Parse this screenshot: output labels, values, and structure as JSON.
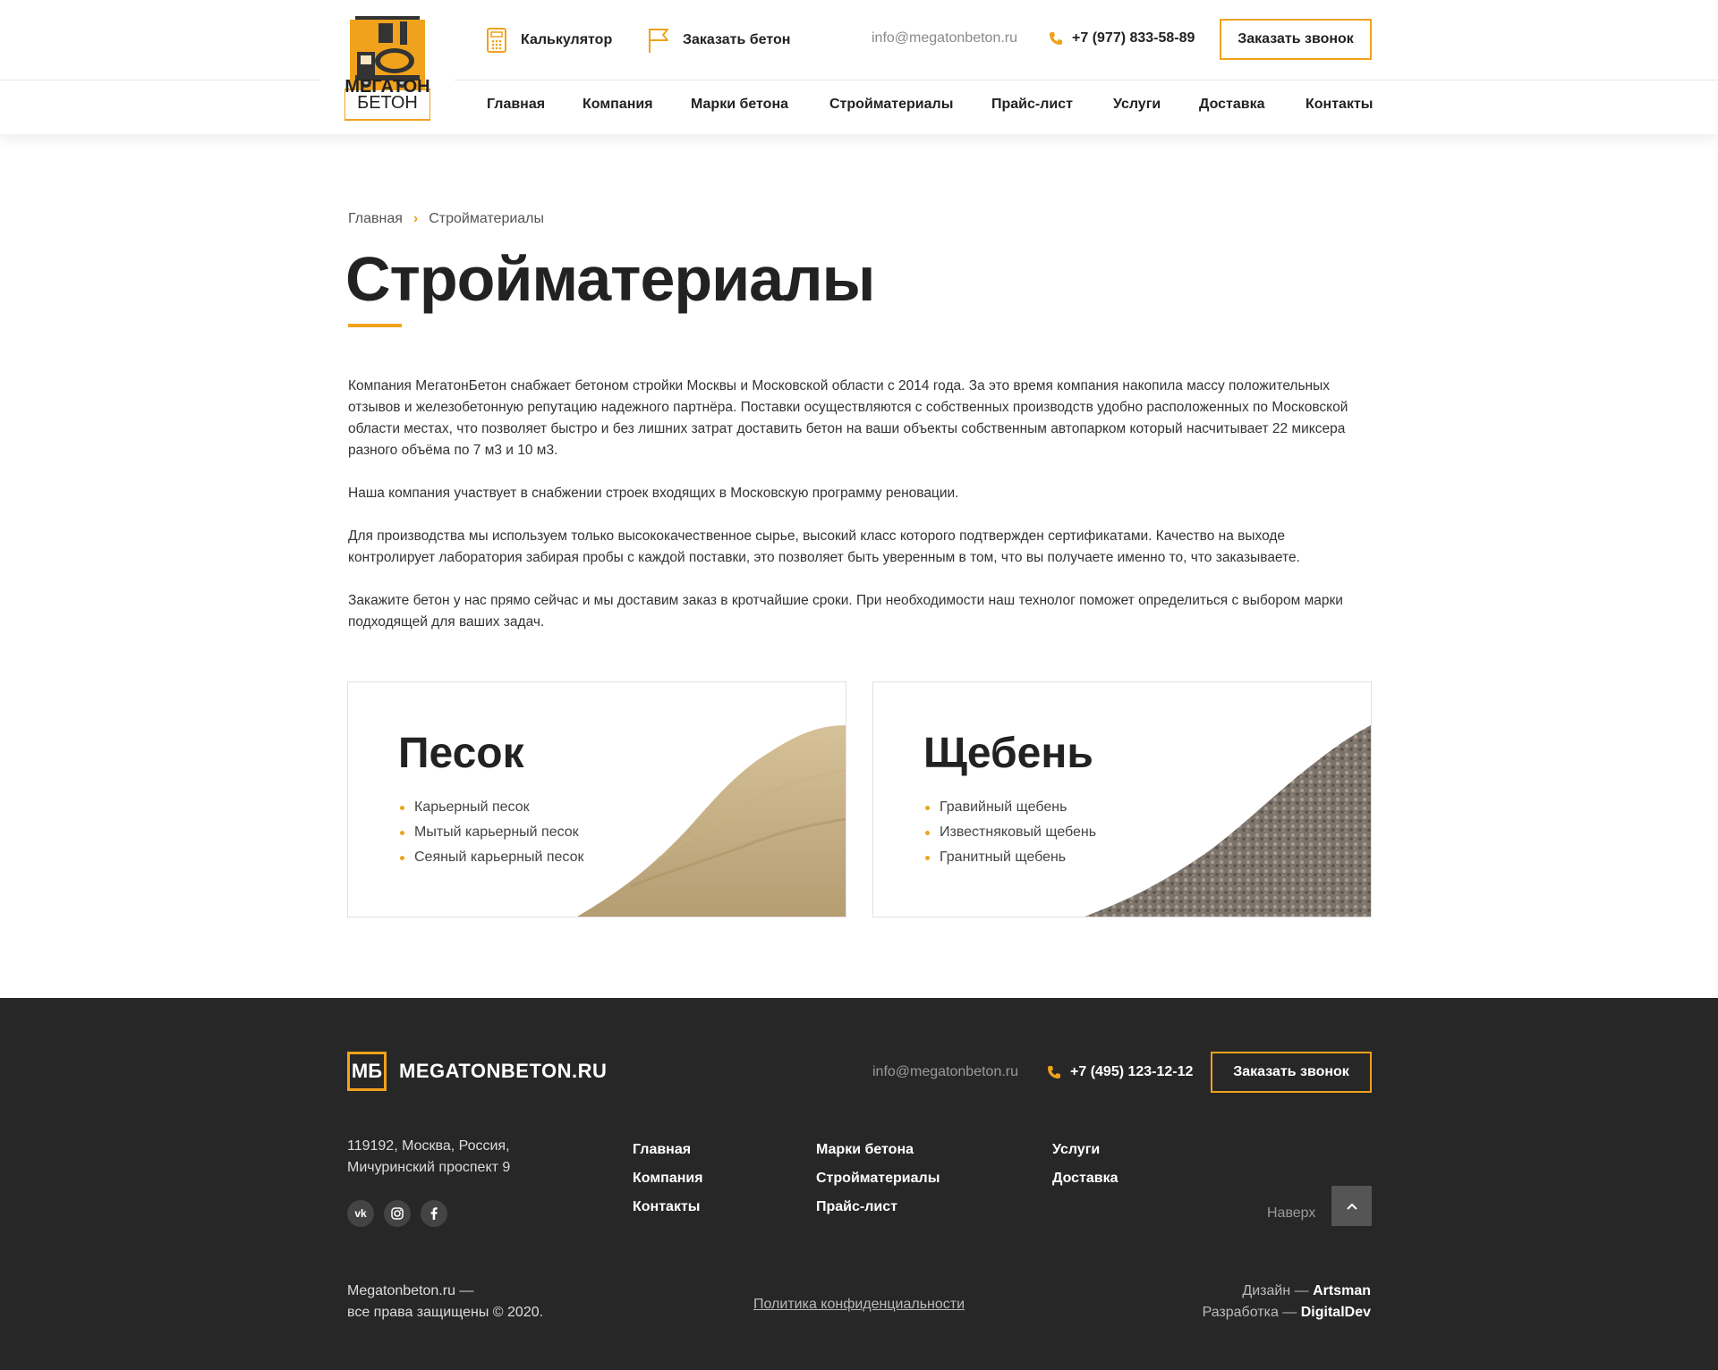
{
  "header": {
    "logo": {
      "line1": "МЕГАТОН",
      "line2": "БЕТОН"
    },
    "calculator_label": "Калькулятор",
    "order_concrete_label": "Заказать бетон",
    "email": "info@megatonbeton.ru",
    "phone": "+7 (977) 833-58-89",
    "call_button": "Заказать звонок",
    "nav": [
      "Главная",
      "Компания",
      "Марки бетона",
      "Стройматериалы",
      "Прайс-лист",
      "Услуги",
      "Доставка",
      "Контакты"
    ]
  },
  "breadcrumb": {
    "home": "Главная",
    "current": "Стройматериалы"
  },
  "page_title": "Стройматериалы",
  "intro": [
    "Компания МегатонБетон снабжает бетоном стройки Москвы и Московской области с 2014 года. За это время компания накопила массу положительных отзывов и железобетонную репутацию надежного партнёра. Поставки осуществляются с собственных производств удобно расположенных по Московской области местах, что позволяет быстро и без лишних затрат доставить бетон на ваши объекты собственным автопарком который насчитывает 22 миксера разного объёма по 7 м3 и 10 м3.",
    "Наша компания участвует в снабжении строек входящих в Московскую программу реновации.",
    "Для производства мы используем только высококачественное сырье, высокий класс которого подтвержден сертификатами. Качество на выходе контролирует лаборатория забирая пробы с каждой поставки, это позволяет быть уверенным в том, что вы получаете именно то, что заказываете.",
    "Закажите бетон у нас прямо сейчас и мы доставим заказ в кротчайшие сроки. При необходимости наш технолог поможет определиться с выбором марки подходящей для ваших задач."
  ],
  "cards": [
    {
      "title": "Песок",
      "items": [
        "Карьерный песок",
        "Мытый карьерный песок",
        "Сеяный карьерный песок"
      ]
    },
    {
      "title": "Щебень",
      "items": [
        "Гравийный щебень",
        "Известняковый щебень",
        "Гранитный щебень"
      ]
    }
  ],
  "footer": {
    "logo_mark": "МБ",
    "logo_name": "MEGATONBETON.RU",
    "email": "info@megatonbeton.ru",
    "phone": "+7 (495) 123-12-12",
    "call_button": "Заказать звонок",
    "address_line1": "119192, Москва, Россия,",
    "address_line2": "Мичуринский проспект 9",
    "social": [
      "vk",
      "instagram",
      "facebook"
    ],
    "menu_col1": [
      "Главная",
      "Компания",
      "Контакты"
    ],
    "menu_col2": [
      "Марки бетона",
      "Стройматериалы",
      "Прайс-лист"
    ],
    "menu_col3": [
      "Услуги",
      "Доставка"
    ],
    "up_label": "Наверх",
    "copyright_line1": "Megatonbeton.ru —",
    "copyright_line2": "все права защищены © 2020.",
    "policy": "Политика конфиденциальности",
    "design_label": "Дизайн —",
    "design_by": "Artsman",
    "dev_label": "Разработка —",
    "dev_by": "DigitalDev"
  },
  "colors": {
    "accent": "#f0a21c",
    "footer_bg": "#272727",
    "text": "#222222"
  }
}
